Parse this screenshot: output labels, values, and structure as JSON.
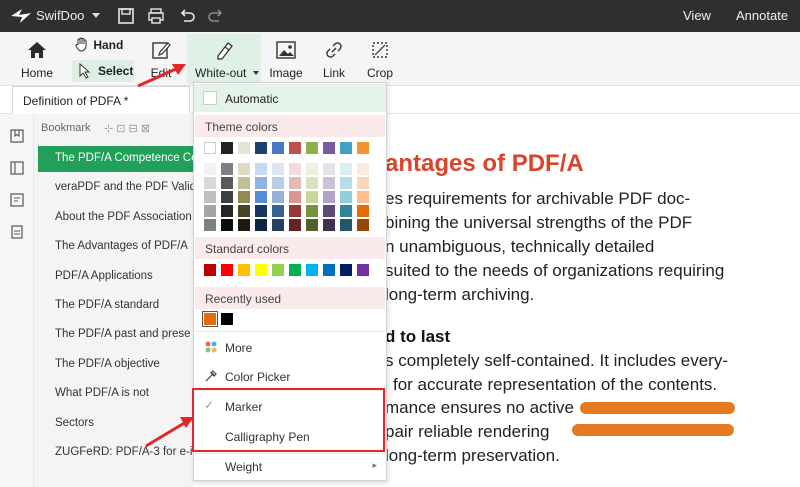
{
  "titlebar": {
    "app_name": "SwifDoo",
    "menus": [
      "View",
      "Annotate"
    ]
  },
  "ribbon": {
    "home_label": "Home",
    "hand_label": "Hand",
    "select_label": "Select",
    "edit_label": "Edit",
    "whiteout_label": "White-out",
    "image_label": "Image",
    "link_label": "Link",
    "crop_label": "Crop"
  },
  "tab": {
    "title": "Definition of PDFA *"
  },
  "bookmark_panel": {
    "header": "Bookmark",
    "items": [
      "The PDF/A Competence Ce",
      "veraPDF and the PDF Valid",
      "About the PDF Association",
      "The Advantages of PDF/A",
      "PDF/A Applications",
      "The PDF/A standard",
      "The PDF/A past and prese",
      "The PDF/A objective",
      "What PDF/A is not",
      "Sectors",
      "ZUGFeRD: PDF/A-3 for e-in"
    ],
    "active_index": 0
  },
  "document": {
    "heading": "antages of PDF/A",
    "para1": [
      "es requirements for archivable PDF doc-",
      "bining the universal strengths of the PDF",
      "n unambiguous, technically detailed",
      "suited to the needs of organizations requiring",
      "long-term archiving."
    ],
    "subheading": "d to last",
    "para2": [
      "s completely self-contained. It includes every-",
      "for accurate representation of the contents.",
      "mance ensures no active",
      "pair reliable rendering",
      "long-term preservation."
    ]
  },
  "dropdown": {
    "automatic": "Automatic",
    "theme_colors": "Theme colors",
    "standard_colors": "Standard colors",
    "recently_used": "Recently used",
    "more": "More",
    "color_picker": "Color Picker",
    "marker": "Marker",
    "calligraphy_pen": "Calligraphy Pen",
    "weight": "Weight",
    "theme_top": [
      "#ffffff",
      "#222222",
      "#e6e2d8",
      "#1f3f6e",
      "#4a78c0",
      "#c0504d",
      "#8db04f",
      "#7a5aa0",
      "#3fa3c4",
      "#f39433"
    ],
    "theme_rows": [
      [
        "#f2f2f2",
        "#7f7f7f",
        "#ddd9c3",
        "#c6d9f1",
        "#dbe5f1",
        "#f2dcdb",
        "#ebf1dd",
        "#e5e0ec",
        "#dbeef3",
        "#fde9d9"
      ],
      [
        "#d9d9d9",
        "#595959",
        "#c4bd97",
        "#8db3e2",
        "#b8cce4",
        "#e5b9b7",
        "#d7e3bc",
        "#ccc1d9",
        "#b7dde8",
        "#fbd5b5"
      ],
      [
        "#bfbfbf",
        "#3f3f3f",
        "#938953",
        "#548dd4",
        "#95b3d7",
        "#d99694",
        "#c3d69b",
        "#b2a2c7",
        "#92cddc",
        "#fac08f"
      ],
      [
        "#a5a5a5",
        "#262626",
        "#494429",
        "#17365d",
        "#366092",
        "#953734",
        "#76923c",
        "#5f497a",
        "#31859b",
        "#e36c09"
      ],
      [
        "#7f7f7f",
        "#0c0c0c",
        "#1d1b10",
        "#0f243e",
        "#244061",
        "#632423",
        "#4f6128",
        "#3f3151",
        "#205867",
        "#974806"
      ]
    ],
    "standard": [
      "#c00000",
      "#ff0000",
      "#ffc000",
      "#ffff00",
      "#92d050",
      "#00b050",
      "#00b0f0",
      "#0070c0",
      "#002060",
      "#7030a0"
    ],
    "recent": [
      "#e36c09",
      "#000000"
    ]
  },
  "colors": {
    "accent": "#22a05a",
    "annotation_red": "#e3262b",
    "scribble_orange": "#e67a22",
    "heading_red": "#d9442b"
  }
}
